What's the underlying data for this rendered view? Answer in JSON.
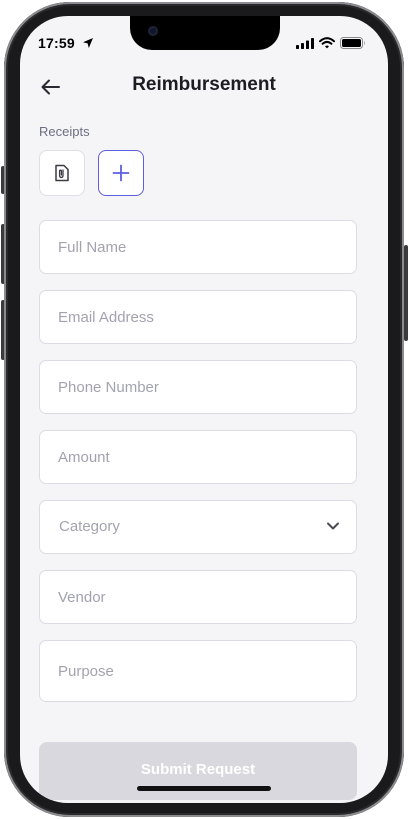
{
  "status_bar": {
    "time": "17:59",
    "icons": [
      "location-arrow-icon",
      "signal-icon",
      "wifi-icon",
      "battery-icon"
    ]
  },
  "header": {
    "back_icon": "arrow-left-icon",
    "title": "Reimbursement"
  },
  "receipts": {
    "label": "Receipts",
    "file_icon": "paperclip-document-icon",
    "add_icon": "plus-icon"
  },
  "form": {
    "full_name_placeholder": "Full Name",
    "email_placeholder": "Email Address",
    "phone_placeholder": "Phone Number",
    "amount_placeholder": "Amount",
    "category_placeholder": "Category",
    "vendor_placeholder": "Vendor",
    "purpose_placeholder": "Purpose"
  },
  "submit": {
    "label": "Submit Request"
  },
  "colors": {
    "accent": "#5a5fe0",
    "screen_bg": "#f5f5f8",
    "disabled_button": "#d8d8de"
  }
}
